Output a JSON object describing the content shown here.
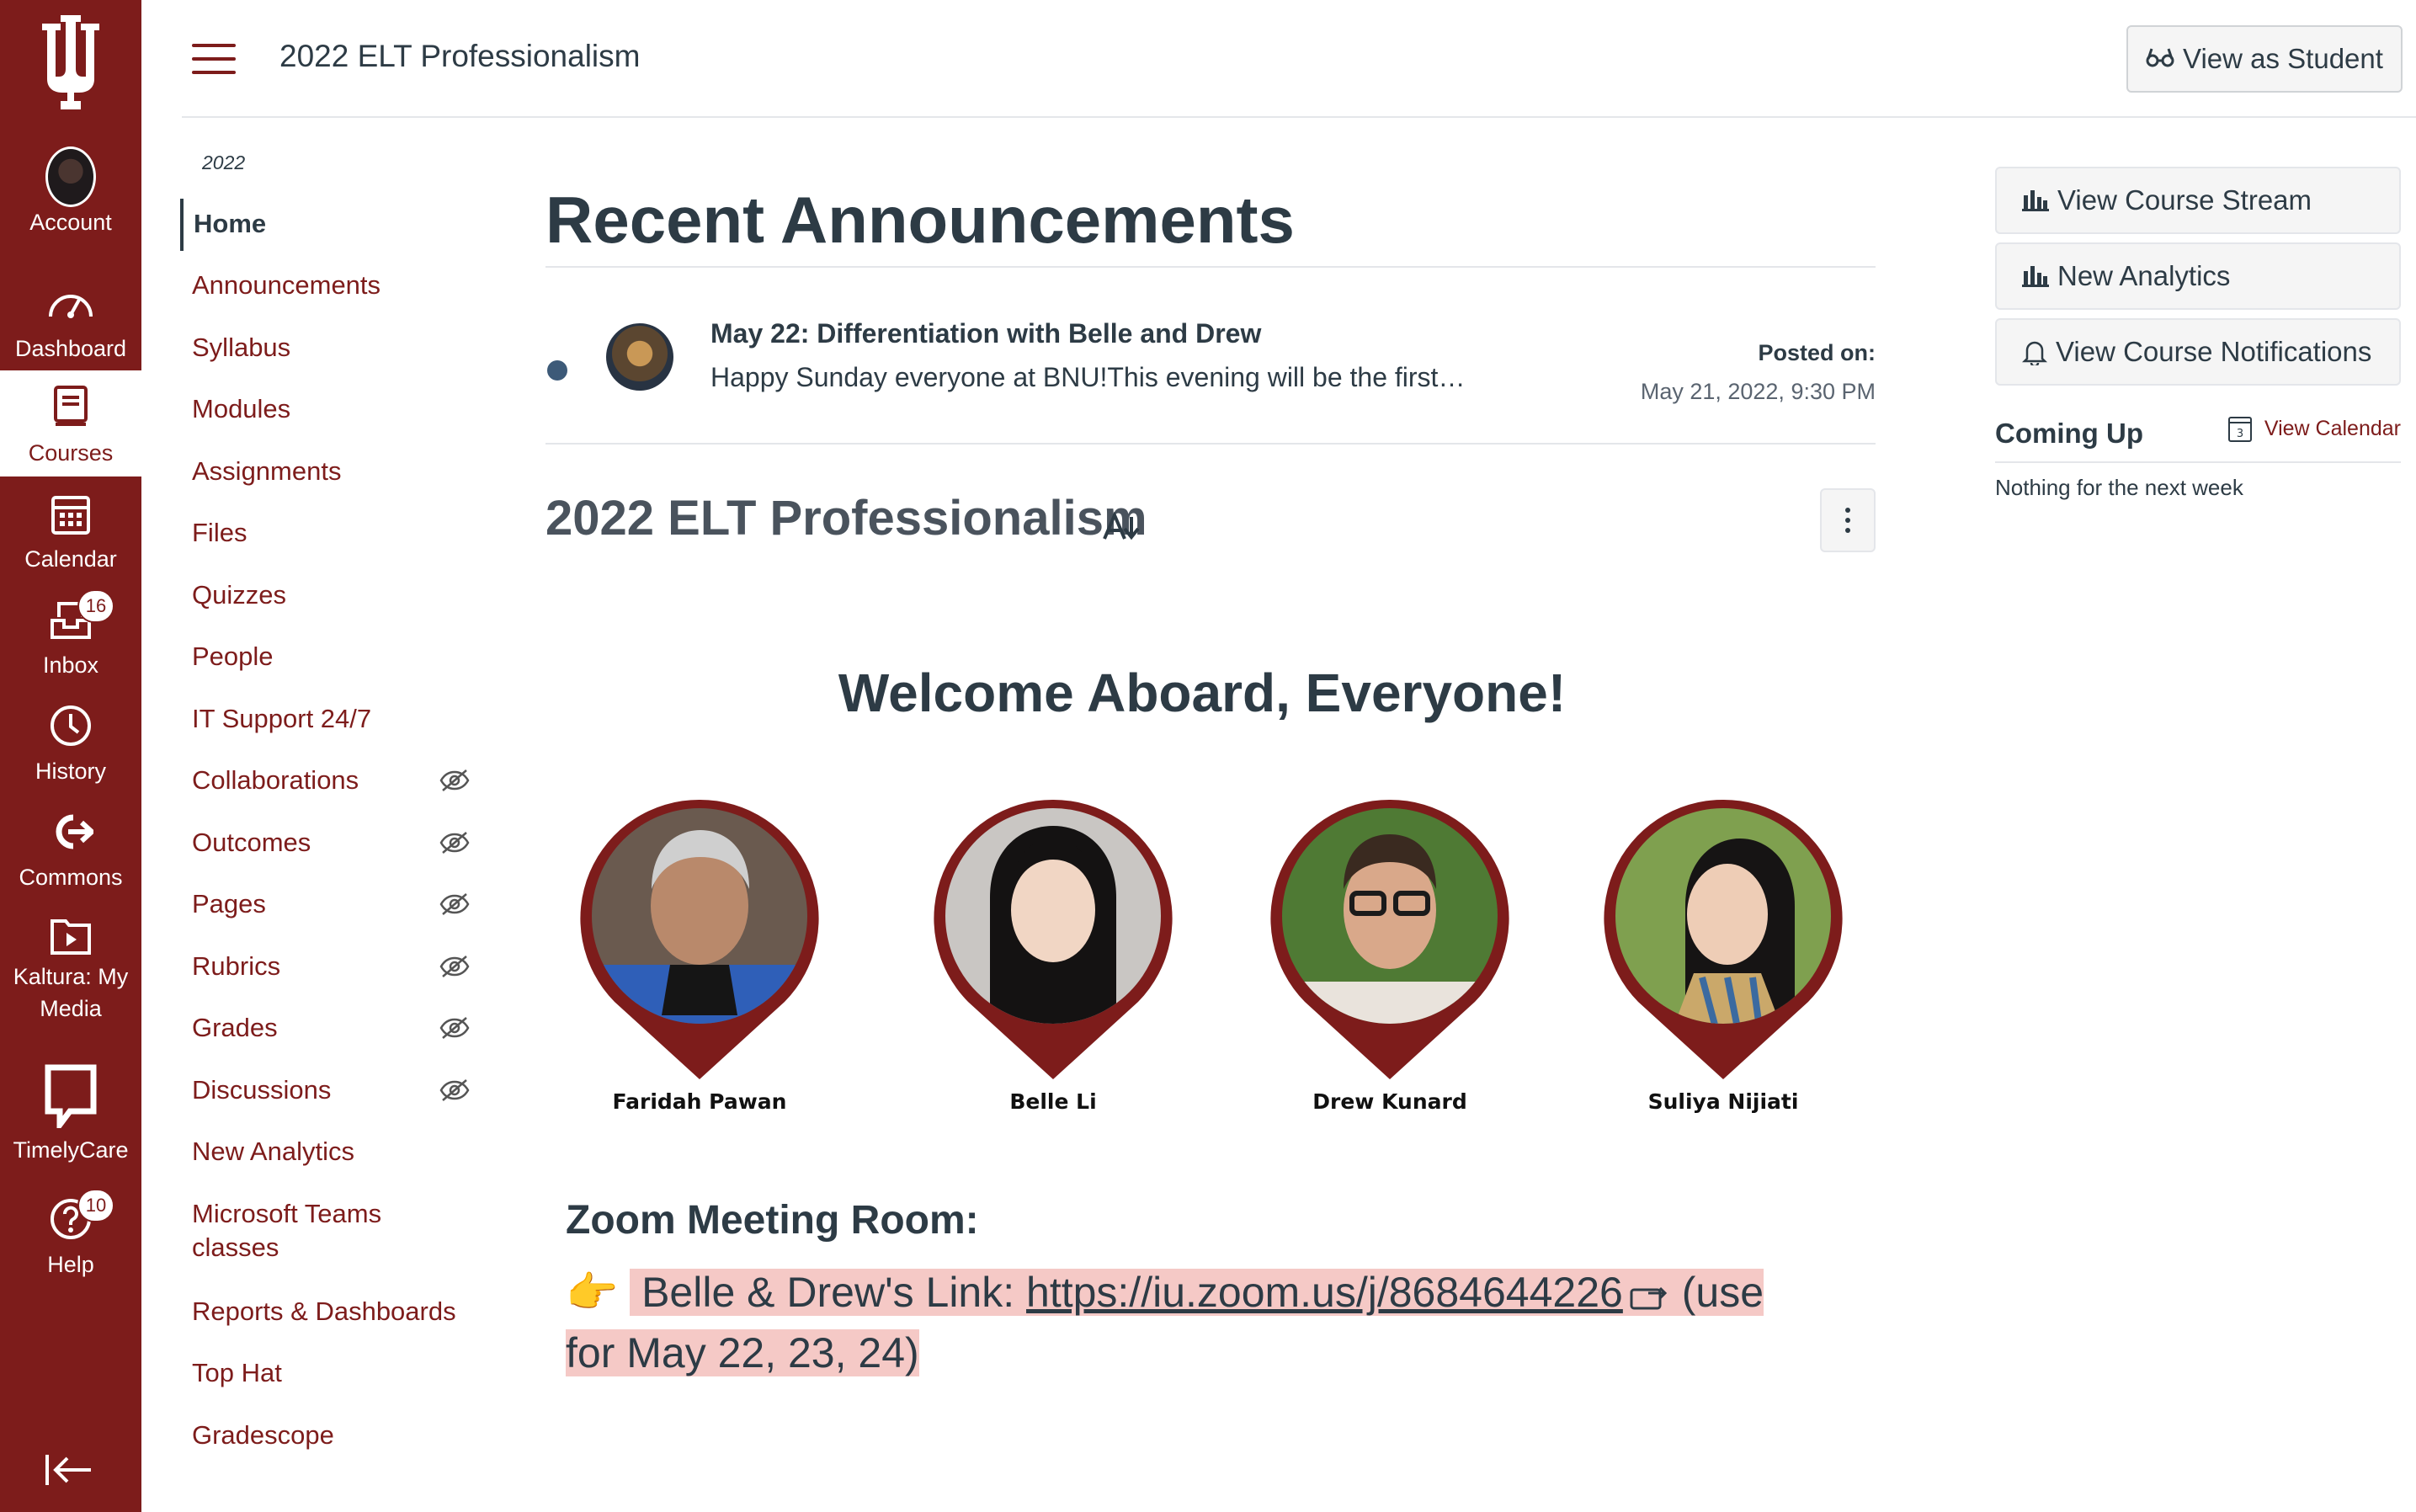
{
  "global_nav": {
    "logo": "indiana-trident-logo",
    "items": [
      {
        "label": "Account",
        "icon": "avatar"
      },
      {
        "label": "Dashboard",
        "icon": "dashboard-icon"
      },
      {
        "label": "Courses",
        "icon": "courses-icon"
      },
      {
        "label": "Calendar",
        "icon": "calendar-icon"
      },
      {
        "label": "Inbox",
        "icon": "inbox-icon",
        "badge": "16"
      },
      {
        "label": "History",
        "icon": "history-icon"
      },
      {
        "label": "Commons",
        "icon": "commons-icon"
      },
      {
        "label": "Kaltura: My Media",
        "icon": "kaltura-icon"
      },
      {
        "label": "TimelyCare",
        "icon": "timelycare-icon"
      },
      {
        "label": "Help",
        "icon": "help-icon",
        "badge": "10"
      }
    ],
    "collapse_icon": "collapse-icon",
    "bg_color": "#7d1c1b"
  },
  "header": {
    "course_title": "2022 ELT Professionalism",
    "view_as_student": "View as Student"
  },
  "course_nav": {
    "term": "2022",
    "items": [
      {
        "label": "Home",
        "active": true
      },
      {
        "label": "Announcements"
      },
      {
        "label": "Syllabus"
      },
      {
        "label": "Modules"
      },
      {
        "label": "Assignments"
      },
      {
        "label": "Files"
      },
      {
        "label": "Quizzes"
      },
      {
        "label": "People"
      },
      {
        "label": "IT Support 24/7"
      },
      {
        "label": "Collaborations",
        "hidden": true
      },
      {
        "label": "Outcomes",
        "hidden": true
      },
      {
        "label": "Pages",
        "hidden": true
      },
      {
        "label": "Rubrics",
        "hidden": true
      },
      {
        "label": "Grades",
        "hidden": true
      },
      {
        "label": "Discussions",
        "hidden": true
      },
      {
        "label": "New Analytics"
      },
      {
        "label": "Microsoft Teams classes"
      },
      {
        "label": "Reports & Dashboards"
      },
      {
        "label": "Top Hat"
      },
      {
        "label": "Gradescope"
      }
    ]
  },
  "main": {
    "recent_announcements_title": "Recent Announcements",
    "announcement": {
      "title": "May 22: Differentiation with Belle and Drew",
      "snippet": "Happy Sunday everyone at BNU!This evening will be the first…",
      "posted_label": "Posted on:",
      "posted_date": "May 21, 2022, 9:30 PM"
    },
    "course_heading": "2022 ELT Professionalism",
    "welcome": "Welcome Aboard, Everyone!",
    "people": [
      {
        "name": "Faridah Pawan"
      },
      {
        "name": "Belle Li"
      },
      {
        "name": "Drew Kunard"
      },
      {
        "name": "Suliya Nijiati"
      }
    ],
    "zoom_title": "Zoom Meeting Room:",
    "zoom_pointer": "👉",
    "zoom_label": "Belle & Drew's Link: ",
    "zoom_link": "https://iu.zoom.us/j/8684644226",
    "zoom_note": " (use for May 22, 23, 24)"
  },
  "right": {
    "buttons": [
      {
        "label": "View Course Stream",
        "icon": "bar-chart-icon"
      },
      {
        "label": "New Analytics",
        "icon": "bar-chart-icon"
      },
      {
        "label": "View Course Notifications",
        "icon": "bell-icon"
      }
    ],
    "coming_up": "Coming Up",
    "view_calendar": "View Calendar",
    "calendar_day": "3",
    "nothing": "Nothing for the next week"
  },
  "colors": {
    "brand": "#7d1c1b",
    "text": "#2d3b45",
    "highlight": "#f5c9c6"
  }
}
